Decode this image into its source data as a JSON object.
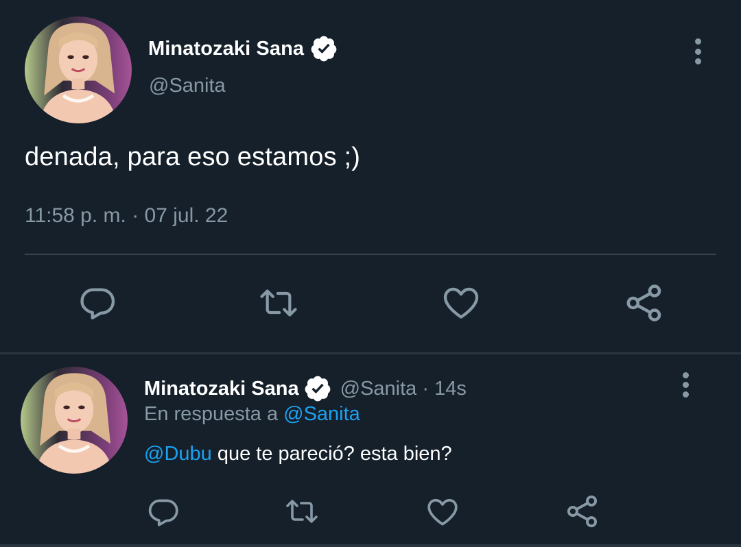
{
  "main_tweet": {
    "author_name": "Minatozaki Sana",
    "author_handle": "@Sanita",
    "text": "denada, para eso estamos ;)",
    "timestamp": "11:58 p. m. · 07 jul. 22",
    "avatar_icon": "profile-photo",
    "verified_icon": "verified-badge-icon",
    "more_icon": "more-vertical-icon"
  },
  "actions": {
    "reply_icon": "reply-icon",
    "retweet_icon": "retweet-icon",
    "like_icon": "heart-icon",
    "share_icon": "share-icon"
  },
  "reply_tweet": {
    "author_name": "Minatozaki Sana",
    "meta": "@Sanita · 14s",
    "in_reply_to_prefix": "En respuesta a",
    "in_reply_to_handle": "@Sanita",
    "mention": "@Dubu",
    "text": "que te pareció? esta bien?"
  },
  "colors": {
    "background": "#15202b",
    "secondary_text": "#8899a6",
    "link": "#1da1f2",
    "divider": "#38444d"
  }
}
